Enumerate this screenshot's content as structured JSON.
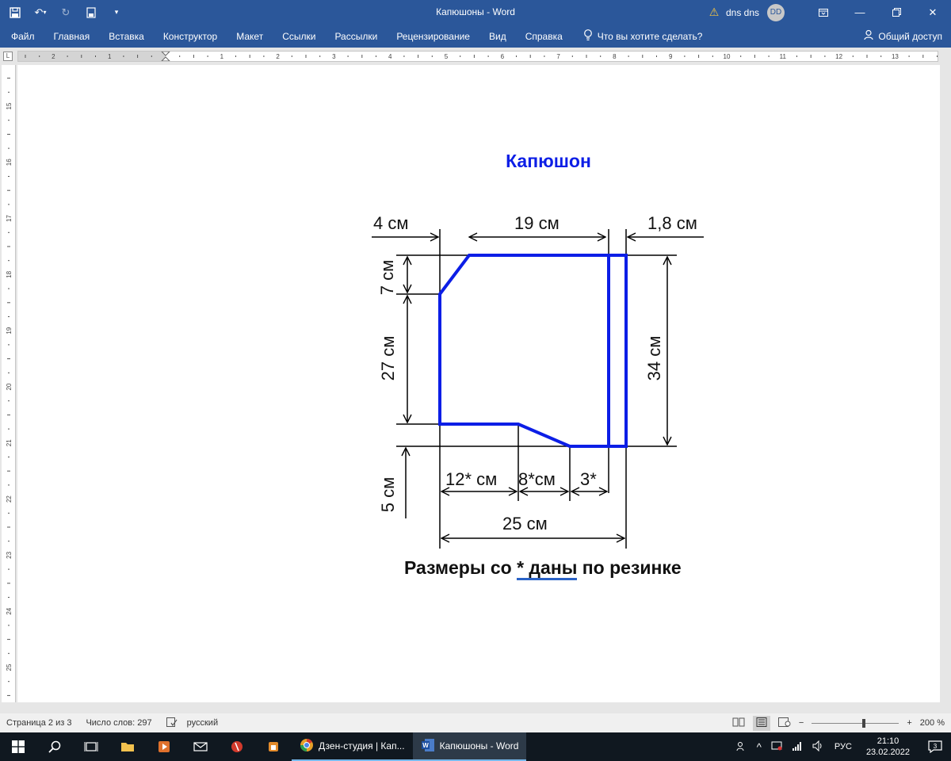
{
  "window": {
    "title": "Капюшоны  -  Word",
    "user": "dns dns",
    "avatar_initials": "DD"
  },
  "ribbon": {
    "tabs": [
      "Файл",
      "Главная",
      "Вставка",
      "Конструктор",
      "Макет",
      "Ссылки",
      "Рассылки",
      "Рецензирование",
      "Вид",
      "Справка"
    ],
    "tell_me": "Что вы хотите сделать?",
    "share": "Общий доступ"
  },
  "ruler": {
    "h_left_labels": [
      "2",
      "1"
    ],
    "h_labels": [
      "1",
      "2",
      "3",
      "4",
      "5",
      "6",
      "7",
      "8",
      "9",
      "10",
      "11",
      "12",
      "13"
    ],
    "v_labels": [
      "15",
      "16",
      "17",
      "18",
      "19",
      "20",
      "21",
      "22",
      "23",
      "24",
      "25"
    ]
  },
  "document": {
    "heading": "Капюшон",
    "dimensions": {
      "top_left": "4 см",
      "top_mid": "19 см",
      "top_right": "1,8 см",
      "left_7": "7 см",
      "left_27": "27 см",
      "left_5": "5 см",
      "right_34": "34 см",
      "bottom_12": "12* см",
      "bottom_8": "8*см",
      "bottom_3": "3*",
      "bottom_25": "25 см"
    },
    "caption_before": "Размеры со ",
    "caption_star": "*  даны",
    "caption_after": " по резинке"
  },
  "statusbar": {
    "page": "Страница 2 из 3",
    "words": "Число слов: 297",
    "language": "русский",
    "zoom": "200 %"
  },
  "taskbar": {
    "apps": [
      "Дзен-студия | Кап...",
      "Капюшоны - Word"
    ],
    "lang": "РУС",
    "time": "21:10",
    "date": "23.02.2022",
    "notifications": "3"
  },
  "colors": {
    "accent": "#2b579a",
    "pattern_line": "#0c1ee6"
  }
}
